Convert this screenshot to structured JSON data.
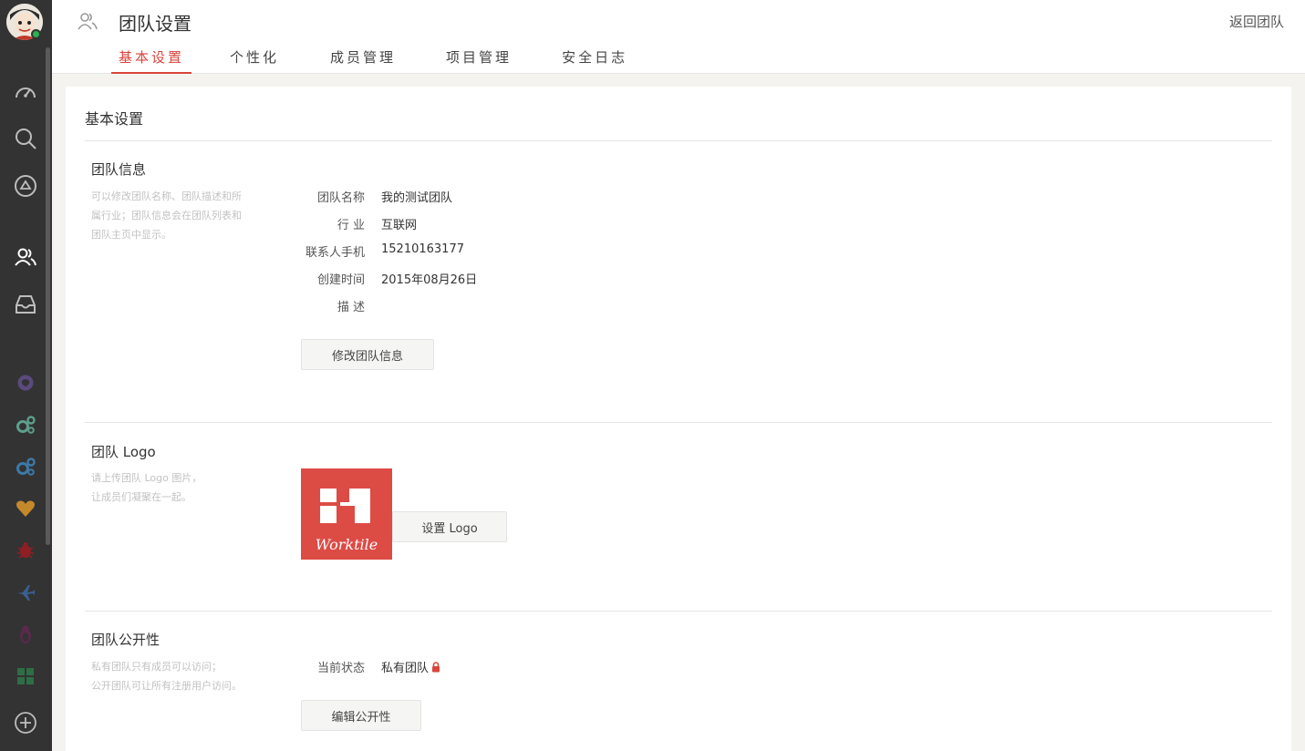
{
  "sidebar": {
    "status_color": "#2bb24c",
    "icons": [
      "dashboard-icon",
      "search-icon",
      "drive-icon",
      "team-icon",
      "inbox-icon",
      "github-icon",
      "gears-icon",
      "gears-icon",
      "heart-icon",
      "bug-icon",
      "plane-icon",
      "linux-icon",
      "windows-icon",
      "add-icon"
    ]
  },
  "header": {
    "title": "团队设置",
    "back_link": "返回团队",
    "tabs": [
      "基本设置",
      "个性化",
      "成员管理",
      "项目管理",
      "安全日志"
    ],
    "active_tab": "基本设置",
    "accent_color": "#d9453d"
  },
  "main": {
    "title": "基本设置",
    "team_info": {
      "title": "团队信息",
      "desc_line1": "可以修改团队名称、团队描述和所",
      "desc_line2": "属行业；团队信息会在团队列表和",
      "desc_line3": "团队主页中显示。",
      "rows": [
        {
          "label": "团队名称",
          "value": "我的测试团队"
        },
        {
          "label": "行 业",
          "value": "互联网"
        },
        {
          "label": "联系人手机",
          "value": "15210163177"
        },
        {
          "label": "创建时间",
          "value": "2015年08月26日"
        },
        {
          "label": "描 述",
          "value": ""
        }
      ],
      "button": "修改团队信息"
    },
    "team_logo": {
      "title": "团队 Logo",
      "desc_line1": "请上传团队 Logo 图片，",
      "desc_line2": "让成员们凝聚在一起。",
      "logo_text": "Worktile",
      "logo_color": "#dd4b45",
      "button": "设置 Logo"
    },
    "team_public": {
      "title": "团队公开性",
      "desc_line1": "私有团队只有成员可以访问；",
      "desc_line2": "公开团队可让所有注册用户访问。",
      "status_label": "当前状态",
      "status_value": "私有团队",
      "button": "编辑公开性"
    }
  }
}
